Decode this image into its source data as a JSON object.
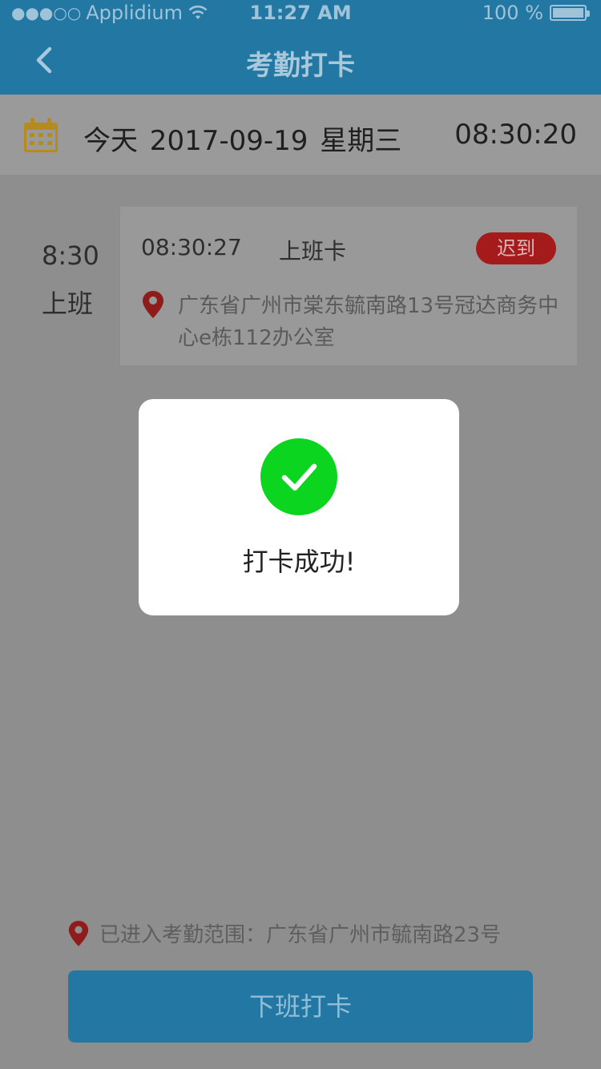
{
  "status_bar": {
    "carrier": "Applidium",
    "time": "11:27 AM",
    "battery": "100 %"
  },
  "nav": {
    "title": "考勤打卡",
    "back_icon": "chevron-left-icon"
  },
  "date_bar": {
    "icon": "calendar-icon",
    "text": "今天   2017-09-19 星期三",
    "clock": "08:30:20"
  },
  "record": {
    "shift_time": "8:30",
    "shift_label": "上班",
    "punch_time": "08:30:27",
    "punch_type": "上班卡",
    "badge": "迟到",
    "address": "广东省广州市棠东毓南路13号冠达商务中心e栋112办公室"
  },
  "modal": {
    "message": "打卡成功!"
  },
  "footer": {
    "range_text": "已进入考勤范围：广东省广州市毓南路23号",
    "button_label": "下班打卡"
  },
  "colors": {
    "primary": "#2377a3",
    "success": "#0bd51f",
    "late": "#a51a1a",
    "calendar": "#b78a1d",
    "pin": "#8f1b1b"
  }
}
